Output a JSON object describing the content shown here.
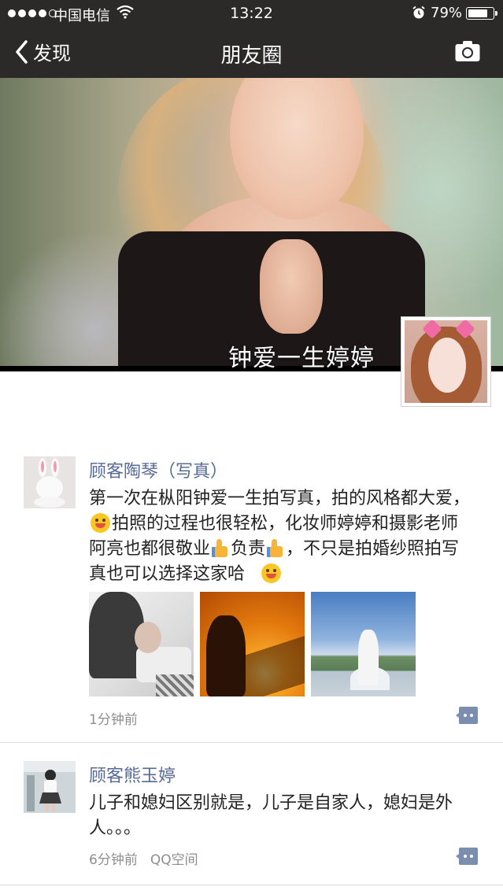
{
  "status_bar": {
    "carrier": "中国电信",
    "time": "13:22",
    "battery_percent": "79%",
    "battery_level": 0.79,
    "signal_bars_filled": 4,
    "signal_bars_total": 5
  },
  "nav": {
    "back_label": "发现",
    "title": "朋友圈",
    "camera_icon": "camera-icon"
  },
  "cover": {
    "name": "钟爱一生婷婷"
  },
  "colors": {
    "nav_background": "#2b2a29",
    "name_link": "#576b95",
    "meta_text": "#8e8e8e",
    "comment_icon": "#7c8eb0"
  },
  "posts": [
    {
      "author": "顾客陶琴（写真）",
      "text_parts": [
        "第一次在枞阳钟爱一生拍写真，拍的风格都大爱，",
        "拍照的过程也很轻松，化妆师婷婷和摄影老师阿亮也都很敬业",
        "负责",
        "，不只是拍婚纱照拍写真也可以选择这家哈"
      ],
      "emojis": [
        "tongue-wink-emoji",
        "thumbs-up-emoji",
        "thumbs-up-emoji",
        "grin-emoji"
      ],
      "image_count": 3,
      "time": "1分钟前",
      "source": ""
    },
    {
      "author": "顾客熊玉婷",
      "text": "儿子和媳妇区别就是，儿子是自家人，媳妇是外人。。。",
      "time": "6分钟前",
      "source": "QQ空间"
    }
  ]
}
